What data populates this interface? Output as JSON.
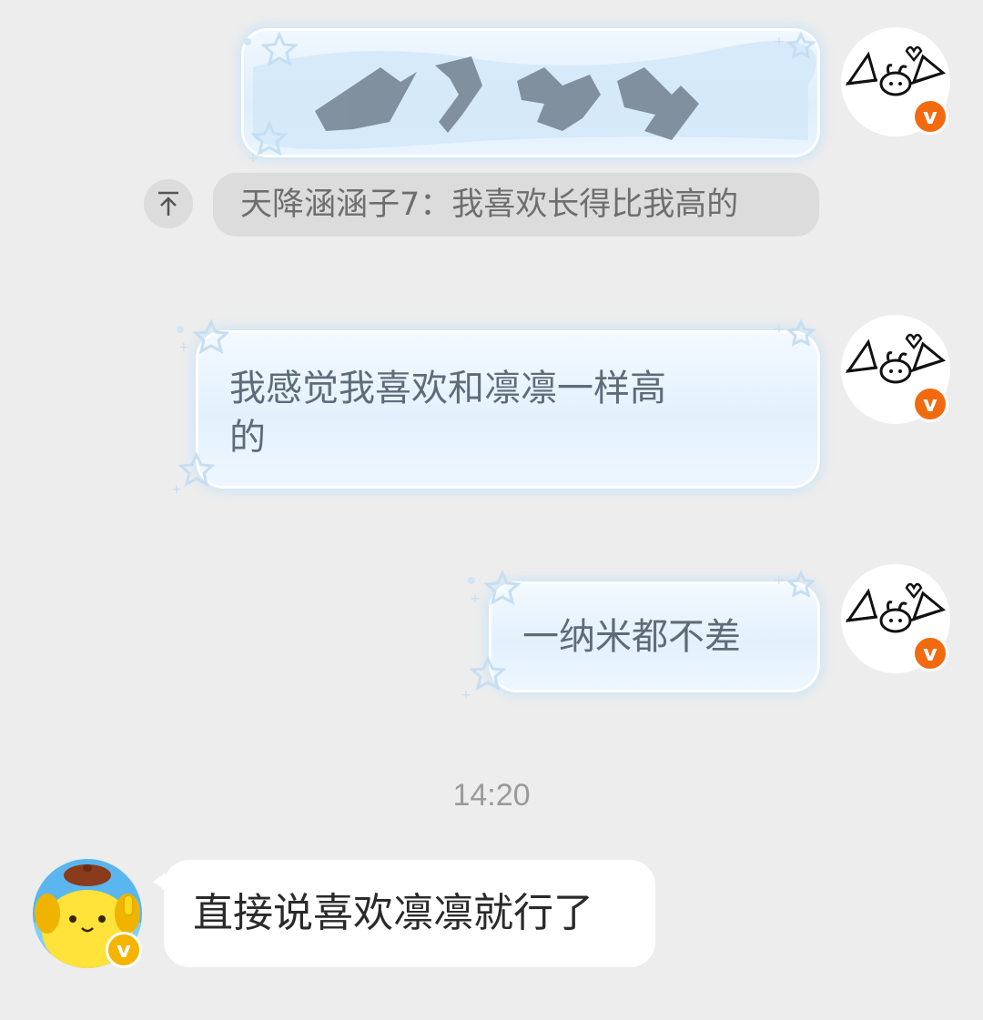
{
  "messages": [
    {
      "side": "right",
      "redacted": true,
      "text": ""
    },
    {
      "side": "right",
      "quote": {
        "sender": "天降涵涵子7",
        "text": "天降涵涵子7：我喜欢长得比我高的"
      }
    },
    {
      "side": "right",
      "line1": "我感觉我喜欢和凛凛一样高",
      "line2": "的"
    },
    {
      "side": "right",
      "text": "一纳米都不差"
    }
  ],
  "timestamp": "14:20",
  "incoming": {
    "side": "left",
    "text": "直接说喜欢凛凛就行了"
  },
  "badges": {
    "verified_letter": "v"
  },
  "colors": {
    "background": "#ededed",
    "bubble_blue": "#e3f1fc",
    "badge_orange": "#f26a10",
    "badge_yellow": "#f4b400"
  },
  "icons": [
    "pin-top-icon",
    "star-decoration-icon",
    "verified-badge-icon"
  ]
}
